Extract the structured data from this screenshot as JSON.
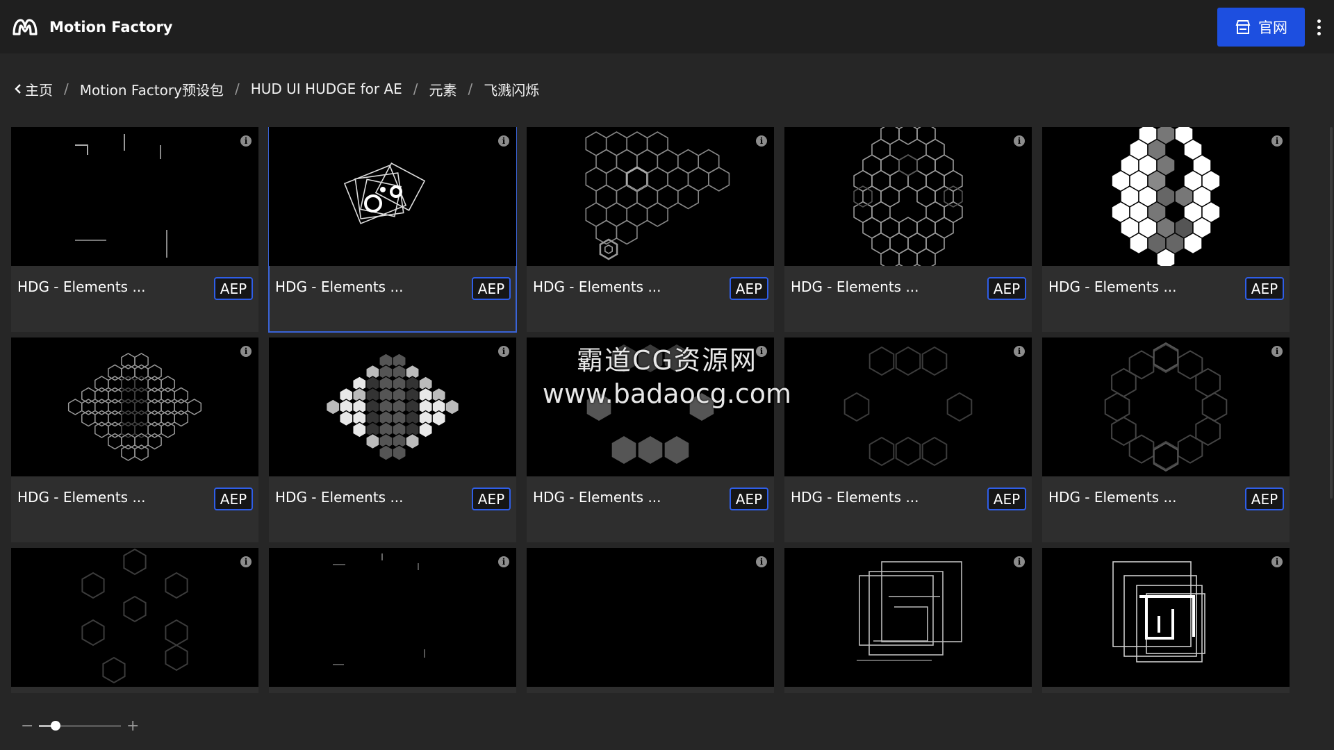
{
  "app": {
    "name": "Motion Factory"
  },
  "header": {
    "site_button_label": "官网",
    "site_icon": "store-icon",
    "more_icon": "more-vertical-icon"
  },
  "breadcrumb": {
    "back_icon": "chevron-left-icon",
    "items": [
      "主页",
      "Motion Factory预设包",
      "HUD UI HUDGE for AE",
      "元素",
      "飞溅闪烁"
    ],
    "separator": "/"
  },
  "grid": {
    "selected_index": 1,
    "items": [
      {
        "title": "HDG - Elements ...",
        "badge": "AEP",
        "thumb": "sparks-lines"
      },
      {
        "title": "HDG - Elements ...",
        "badge": "AEP",
        "thumb": "rotating-squares"
      },
      {
        "title": "HDG - Elements ...",
        "badge": "AEP",
        "thumb": "hex-cluster-outline"
      },
      {
        "title": "HDG - Elements ...",
        "badge": "AEP",
        "thumb": "hex-ring-outline"
      },
      {
        "title": "HDG - Elements ...",
        "badge": "AEP",
        "thumb": "hex-ring-filled"
      },
      {
        "title": "HDG - Elements ...",
        "badge": "AEP",
        "thumb": "hex-diamond-outline"
      },
      {
        "title": "HDG - Elements ...",
        "badge": "AEP",
        "thumb": "hex-diamond-filled"
      },
      {
        "title": "HDG - Elements ...",
        "badge": "AEP",
        "thumb": "hex-scattered-filled"
      },
      {
        "title": "HDG - Elements ...",
        "badge": "AEP",
        "thumb": "hex-scattered-outline"
      },
      {
        "title": "HDG - Elements ...",
        "badge": "AEP",
        "thumb": "hex-circle-outline"
      },
      {
        "title": "",
        "badge": "",
        "thumb": "hex-sparse-outline"
      },
      {
        "title": "",
        "badge": "",
        "thumb": "sparks-dots"
      },
      {
        "title": "",
        "badge": "",
        "thumb": "blank"
      },
      {
        "title": "",
        "badge": "",
        "thumb": "nested-squares"
      },
      {
        "title": "",
        "badge": "",
        "thumb": "nested-squares-bold"
      }
    ]
  },
  "zoom": {
    "minus_label": "−",
    "plus_label": "+",
    "value": 0.2
  },
  "watermark": {
    "line1": "霸道CG资源网",
    "line2": "www.badaocg.com"
  },
  "colors": {
    "accent": "#1d4fe0",
    "badge_border": "#2f5ee8",
    "background": "#262626",
    "topbar": "#1f1f1f",
    "card": "#2e2e2e"
  }
}
